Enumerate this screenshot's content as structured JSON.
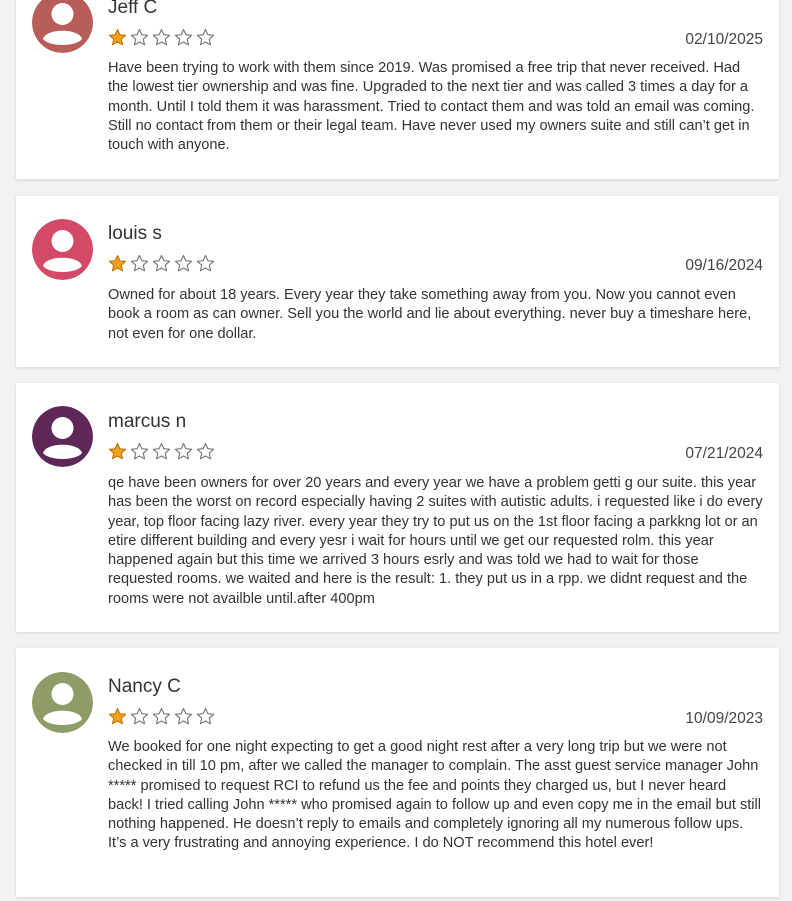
{
  "colors": {
    "star_filled": "#f4a01c",
    "star_empty_stroke": "#777777",
    "avatar_jeff": "#b85e5a",
    "avatar_louis": "#d24a66",
    "avatar_marcus": "#5e2758",
    "avatar_nancy": "#8e9c68"
  },
  "reviews": [
    {
      "name": "Jeff C",
      "rating": 1,
      "max_rating": 5,
      "date": "02/10/2025",
      "text": "Have been trying to work with them since 2019. Was promised a free trip that never received. Had the lowest tier ownership and was fine. Upgraded to the next tier and was called 3 times a day for a month. Until I told them it was harassment. Tried to contact them and was told an email was coming. Still no contact from them or their legal team. Have never used my owners suite and still can’t get in touch with anyone."
    },
    {
      "name": "louis s",
      "rating": 1,
      "max_rating": 5,
      "date": "09/16/2024",
      "text": "Owned for about 18 years. Every year they take something away from you. Now you cannot even book a room as can owner. Sell you the world and lie about everything. never buy a timeshare here, not even for one dollar."
    },
    {
      "name": "marcus n",
      "rating": 1,
      "max_rating": 5,
      "date": "07/21/2024",
      "text": "qe have been owners for over 20 years and every year we have a problem getti g our suite. this year has been the worst on record especially having 2 suites with autistic adults. i requested like i do every year, top floor facing lazy river. every year they try to put us on the 1st floor facing a parkkng lot or an etire different building and every yesr i wait for hours until we get our requested rolm. this year happened again but this time we arrived 3 hours esrly and was told we had to wait for those requested rooms. we waited and here is the result: 1. they put us in a rpp. we didnt request and the rooms were not availble until.after 400pm"
    },
    {
      "name": "Nancy C",
      "rating": 1,
      "max_rating": 5,
      "date": "10/09/2023",
      "text": "We booked for one night expecting to get a good night rest after a very long trip but we were not checked in till 10 pm, after we called the manager to complain. The asst guest service manager John ***** promised to request RCI to refund us the fee and points they charged us, but I never heard back! I tried calling John ***** who promised again to follow up and even copy me in the email but still nothing happened. He doesn’t reply to emails and completely ignoring all my numerous follow ups. It’s a very frustrating and annoying experience. I do NOT recommend this hotel ever!"
    }
  ]
}
